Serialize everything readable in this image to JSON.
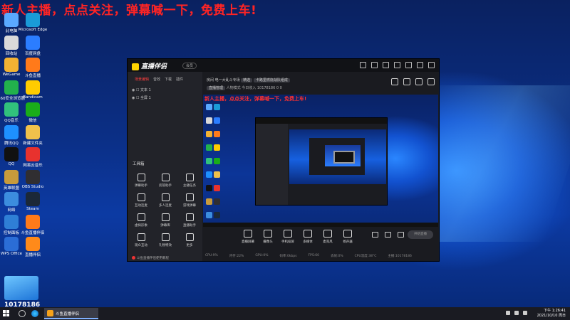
{
  "promo_text": "新人主播，点点关注，弹幕喊一下，免费上车!",
  "desktop_icons": [
    {
      "label": "此电脑",
      "color": "#5aa9ff"
    },
    {
      "label": "Microsoft Edge",
      "color": "#1a9bd7"
    },
    {
      "label": "回收站",
      "color": "#d9d9d9"
    },
    {
      "label": "百度网盘",
      "color": "#2b7dff"
    },
    {
      "label": "WeGame",
      "color": "#f2b233"
    },
    {
      "label": "斗鱼直播",
      "color": "#ff7a1a"
    },
    {
      "label": "360安全浏览器",
      "color": "#22b14c"
    },
    {
      "label": "Bandicam",
      "color": "#ffcc00"
    },
    {
      "label": "QQ音乐",
      "color": "#31c27c"
    },
    {
      "label": "微信",
      "color": "#1aad19"
    },
    {
      "label": "腾讯QQ",
      "color": "#1e90ff"
    },
    {
      "label": "新建文件夹",
      "color": "#f0c14b"
    },
    {
      "label": "QQ",
      "color": "#111111"
    },
    {
      "label": "网易云音乐",
      "color": "#e8322e"
    },
    {
      "label": "英雄联盟",
      "color": "#c89b3c"
    },
    {
      "label": "OBS Studio",
      "color": "#302e31"
    },
    {
      "label": "网络",
      "color": "#3c8dde"
    },
    {
      "label": "Steam",
      "color": "#1b2838"
    },
    {
      "label": "控制面板",
      "color": "#2f7fd6"
    },
    {
      "label": "斗鱼直播伴侣",
      "color": "#ff7a1a"
    },
    {
      "label": "WPS Office",
      "color": "#2b6dd6"
    },
    {
      "label": "直播伴侣",
      "color": "#ff8a1a"
    }
  ],
  "douyu_room": "10178186",
  "app": {
    "name": "直播伴侣",
    "vip_label": "会员",
    "scene_tabs": [
      "场景编辑",
      "音效",
      "下载",
      "插件"
    ],
    "sources": [
      "文本 1",
      "全屏 1"
    ],
    "tools_title": "工具箱",
    "tools": [
      [
        "弹幕助手",
        "房管助手",
        "主播任务"
      ],
      [
        "互动连麦",
        "多人连麦",
        "游戏弹幕"
      ],
      [
        "虚拟形象",
        "弹幕库",
        "直播助手"
      ],
      [
        "观众互动",
        "礼物特效",
        "更多"
      ]
    ],
    "notice": "斗鱼直播伴侣使用教程",
    "stream_info": {
      "room_label": "房间",
      "title": "电一大乱斗专场",
      "tag": "精选",
      "category": "卡路里燃烧战队组成",
      "line2_tag": "直播管理",
      "line2_mode": "人物模式",
      "line2_extra": "今日收入",
      "room_id": "10178186",
      "likes": "0",
      "fans": "0"
    },
    "preview_promo": "新人主播，点点关注，弹幕喊一下，免费上车!",
    "controls": [
      "直播屏幕",
      "摄像头",
      "手机投屏",
      "多媒体",
      "麦克风",
      "扬声器"
    ],
    "go_live": "开始直播",
    "stats": [
      "CPU:9%",
      "内存:22%",
      "GPU:0%",
      "码率:0kbps",
      "FPS:60",
      "丢帧:0%",
      "CPU温度:38°C",
      "主播:10178186"
    ]
  },
  "taskbar": {
    "active_app": "斗鱼直播伴侣",
    "time": "下午 1:26:41",
    "date": "2021/10/10 周日"
  }
}
